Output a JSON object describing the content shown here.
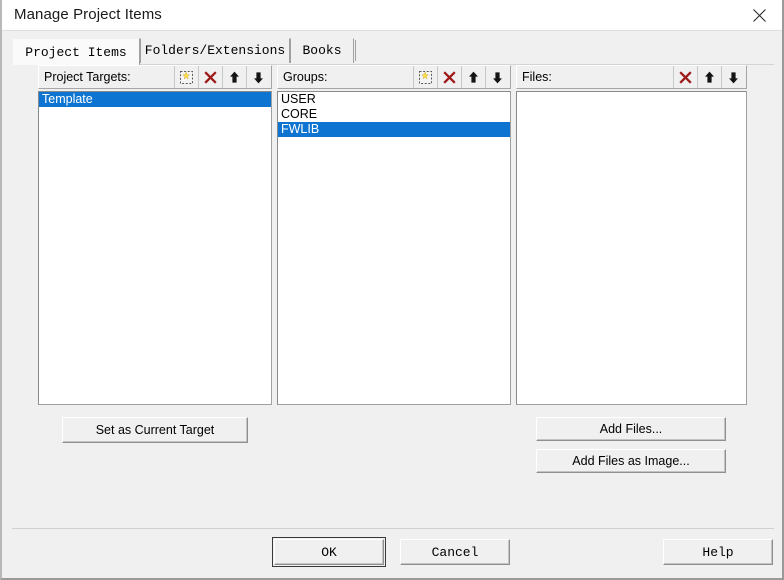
{
  "window": {
    "title": "Manage Project Items",
    "close_icon": "close-icon"
  },
  "tabs": [
    {
      "label": "Project Items",
      "active": true
    },
    {
      "label": "Folders/Extensions",
      "active": false
    },
    {
      "label": "Books",
      "active": false
    }
  ],
  "columns": {
    "project_targets": {
      "caption": "Project Targets:",
      "actions": [
        {
          "name": "new-item-icon",
          "label": "New (Insert)"
        },
        {
          "name": "delete-icon",
          "label": "Remove Item"
        },
        {
          "name": "move-up-icon",
          "label": "Move Up"
        },
        {
          "name": "move-down-icon",
          "label": "Move Down"
        }
      ],
      "items": [
        {
          "label": "Template",
          "selected": true
        }
      ]
    },
    "groups": {
      "caption": "Groups:",
      "actions": [
        {
          "name": "new-item-icon",
          "label": "New (Insert)"
        },
        {
          "name": "delete-icon",
          "label": "Remove Item"
        },
        {
          "name": "move-up-icon",
          "label": "Move Up"
        },
        {
          "name": "move-down-icon",
          "label": "Move Down"
        }
      ],
      "items": [
        {
          "label": "USER",
          "selected": false
        },
        {
          "label": "CORE",
          "selected": false
        },
        {
          "label": "FWLIB",
          "selected": true
        }
      ]
    },
    "files": {
      "caption": "Files:",
      "actions": [
        {
          "name": "delete-icon",
          "label": "Remove Item"
        },
        {
          "name": "move-up-icon",
          "label": "Move Up"
        },
        {
          "name": "move-down-icon",
          "label": "Move Down"
        }
      ],
      "items": []
    }
  },
  "buttons": {
    "set_current_target": "Set as Current Target",
    "add_files": "Add Files...",
    "add_files_as_image": "Add Files as Image...",
    "ok": "OK",
    "cancel": "Cancel",
    "help": "Help"
  },
  "colors": {
    "selection": "#0d75d1",
    "delete_icon": "#9e1b1b",
    "new_icon_accent": "#ffe14d",
    "dialog_background": "#f0f0f0",
    "listbox_background": "#ffffff"
  }
}
